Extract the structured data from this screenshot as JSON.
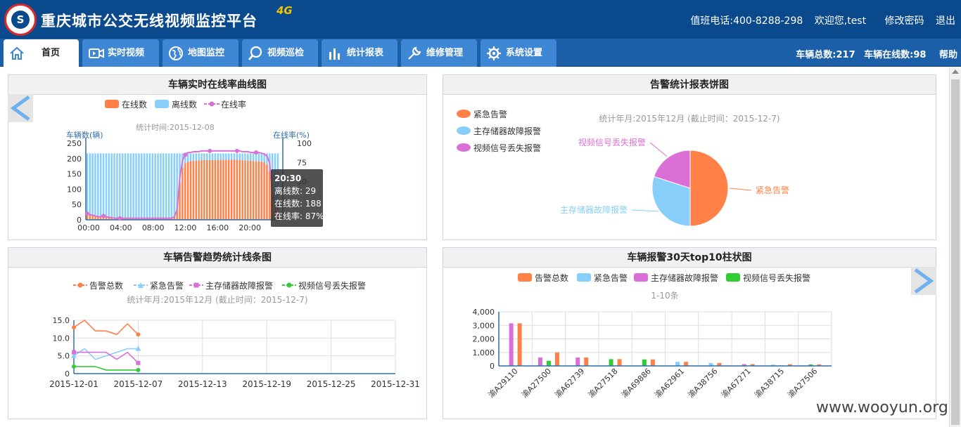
{
  "header": {
    "title": "重庆城市公交无线视频监控平台",
    "badge": "4G",
    "logo_glyph": "S",
    "phone": "值班电话:400-8288-298",
    "welcome": "欢迎您,test",
    "change_password": "修改密码",
    "logout": "退出"
  },
  "nav": {
    "tabs": [
      {
        "label": "首页",
        "icon": "home-icon"
      },
      {
        "label": "实时视频",
        "icon": "video-camera-icon"
      },
      {
        "label": "地图监控",
        "icon": "globe-icon"
      },
      {
        "label": "视频巡检",
        "icon": "search-icon"
      },
      {
        "label": "统计报表",
        "icon": "bar-chart-icon"
      },
      {
        "label": "维修管理",
        "icon": "wrench-icon"
      },
      {
        "label": "系统设置",
        "icon": "gear-icon"
      }
    ],
    "active_tab": "首页",
    "vehicle_total": "车辆总数:217",
    "vehicle_online": "车辆在线数:98",
    "help": "帮助"
  },
  "colors": {
    "header_bg": "#0a4a8c",
    "nav_bg": "#1a5fa8",
    "tab_bg": "#3e87d4",
    "orange": "#ff8147",
    "light_blue": "#87cefa",
    "magenta": "#da70d6",
    "green": "#32cd32"
  },
  "panels": {
    "online_curve": "车辆实时在线率曲线图",
    "alarm_pie": "告警统计报表饼图",
    "alarm_trend": "车辆告警趋势统计线条图",
    "top10": "车辆报警30天top10柱状图"
  },
  "watermark": "www.wooyun.org",
  "chart_data": [
    {
      "type": "bar",
      "title": "车辆实时在线率曲线图",
      "subtitle": "统计时间:2015-12-08",
      "ylabel": "车辆数(辆)",
      "ylabel2": "在线率(%)",
      "ylim": [
        0,
        250
      ],
      "y2lim": [
        0,
        100
      ],
      "yticks": [
        "250",
        "200",
        "150",
        "100",
        "50",
        "0"
      ],
      "y2ticks": [
        "100",
        "75",
        "50"
      ],
      "xticks": [
        "00:00",
        "04:00",
        "08:00",
        "12:00",
        "16:00",
        "20:00"
      ],
      "legend": [
        "在线数",
        "离线数",
        "在线率"
      ],
      "stacked_series": [
        {
          "name": "在线数",
          "color": "#ff8147"
        },
        {
          "name": "离线数",
          "color": "#87cefa"
        }
      ],
      "total_per_bin": 217,
      "online_per_bin": [
        17,
        15,
        13,
        11,
        9,
        8,
        10,
        9,
        7,
        6,
        5,
        5,
        5,
        4,
        4,
        4,
        5,
        5,
        4,
        5,
        4,
        4,
        4,
        4,
        4,
        4,
        4,
        5,
        4,
        4,
        5,
        4,
        9,
        30,
        120,
        170,
        185,
        190,
        192,
        193,
        193,
        194,
        195,
        195,
        195,
        195,
        195,
        195,
        196,
        196,
        196,
        196,
        196,
        196,
        196,
        196,
        195,
        195,
        194,
        193,
        193,
        192,
        192,
        191,
        190,
        188,
        180,
        160,
        80,
        40,
        30
      ],
      "rate_percent": [
        8,
        7,
        6,
        5,
        4,
        4,
        5,
        4,
        3,
        3,
        2,
        2,
        2,
        2,
        2,
        2,
        2,
        2,
        2,
        2,
        2,
        2,
        2,
        2,
        2,
        2,
        2,
        2,
        2,
        2,
        2,
        2,
        4,
        14,
        55,
        78,
        85,
        88,
        88,
        89,
        89,
        89,
        90,
        90,
        90,
        90,
        90,
        90,
        90,
        90,
        90,
        90,
        90,
        90,
        90,
        90,
        90,
        89,
        89,
        89,
        88,
        88,
        88,
        88,
        87,
        86,
        83,
        74,
        37,
        18,
        14
      ],
      "tooltip": {
        "time": "20:30",
        "offline": "离线数: 29",
        "online": "在线数: 188",
        "rate": "在线率: 87%"
      }
    },
    {
      "type": "pie",
      "title": "告警统计报表饼图",
      "subtitle": "统计年月:2015年12月 (截止时间：2015-12-7)",
      "slices": [
        {
          "name": "紧急告警",
          "value": 50,
          "color": "#ff8147"
        },
        {
          "name": "主存储器故障报警",
          "value": 30,
          "color": "#87cefa"
        },
        {
          "name": "视频信号丢失报警",
          "value": 20,
          "color": "#da70d6"
        }
      ]
    },
    {
      "type": "line",
      "title": "车辆告警趋势统计线条图",
      "subtitle": "统计年月:2015年12月 (截止时间：2015-12-7)",
      "ylim": [
        0,
        15
      ],
      "yticks": [
        "15.0",
        "10.0",
        "5.0",
        "0"
      ],
      "xticks": [
        "2015-12-01",
        "2015-12-07",
        "2015-12-13",
        "2015-12-19",
        "2015-12-25",
        "2015-12-31"
      ],
      "x": [
        1,
        2,
        3,
        4,
        5,
        6,
        7
      ],
      "series": [
        {
          "name": "告警总数",
          "color": "#ff8147",
          "marker": "circle",
          "values": [
            13,
            15,
            12,
            12,
            11,
            14,
            11
          ]
        },
        {
          "name": "紧急告警",
          "color": "#87cefa",
          "marker": "triangle",
          "values": [
            5,
            7,
            4,
            5,
            6,
            7,
            7
          ]
        },
        {
          "name": "主存储器故障报警",
          "color": "#da70d6",
          "marker": "square",
          "values": [
            6,
            6,
            6,
            6,
            4,
            6,
            3
          ]
        },
        {
          "name": "视频信号丢失报警",
          "color": "#32cd32",
          "marker": "circle",
          "values": [
            2,
            2,
            2,
            1,
            1,
            1,
            1
          ]
        }
      ]
    },
    {
      "type": "bar",
      "title": "车辆报警30天top10柱状图",
      "subtitle": "1-10条",
      "ylim": [
        0,
        4000
      ],
      "yticks": [
        "4,000",
        "3,000",
        "2,000",
        "1,000",
        "0"
      ],
      "categories": [
        "渝A29110",
        "渝A27500",
        "渝A62739",
        "渝A27518",
        "渝A69886",
        "渝A62961",
        "渝A38756",
        "渝A67271",
        "渝A38715",
        "渝A27506"
      ],
      "series": [
        {
          "name": "告警总数",
          "color": "#ff8147",
          "values": [
            3150,
            1000,
            620,
            500,
            480,
            300,
            220,
            130,
            120,
            110
          ]
        },
        {
          "name": "紧急告警",
          "color": "#87cefa",
          "values": [
            0,
            0,
            0,
            0,
            0,
            300,
            220,
            0,
            90,
            0
          ]
        },
        {
          "name": "主存储器故障报警",
          "color": "#da70d6",
          "values": [
            3150,
            620,
            620,
            0,
            0,
            0,
            0,
            130,
            0,
            0
          ]
        },
        {
          "name": "视频信号丢失报警",
          "color": "#32cd32",
          "values": [
            0,
            380,
            0,
            500,
            480,
            0,
            0,
            0,
            30,
            110
          ]
        }
      ]
    }
  ]
}
